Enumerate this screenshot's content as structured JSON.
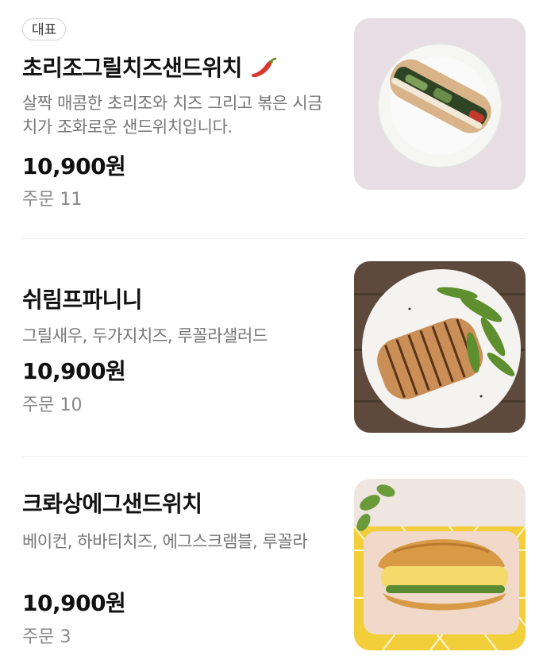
{
  "menu_items": [
    {
      "badge": "대표",
      "name": "초리조그릴치즈샌드위치",
      "spicy_icon": "chili-pepper-icon",
      "description": "살짝 매콤한 초리조와 치즈 그리고 볶은 시금치가 조화로운 샌드위치입니다.",
      "price": "10,900원",
      "orders": "주문 11"
    },
    {
      "name": "쉬림프파니니",
      "description": "그릴새우, 두가지치즈, 루꼴라샐러드",
      "price": "10,900원",
      "orders": "주문 10"
    },
    {
      "name": "크롸상에그샌드위치",
      "description": "베이컨, 하바티치즈, 에그스크램블, 루꼴라",
      "price": "10,900원",
      "orders": "주문 3"
    }
  ],
  "colors": {
    "title": "#111111",
    "description": "#777777",
    "orders": "#888888",
    "divider": "#eeeeee",
    "badge_border": "#d4d4d4"
  }
}
